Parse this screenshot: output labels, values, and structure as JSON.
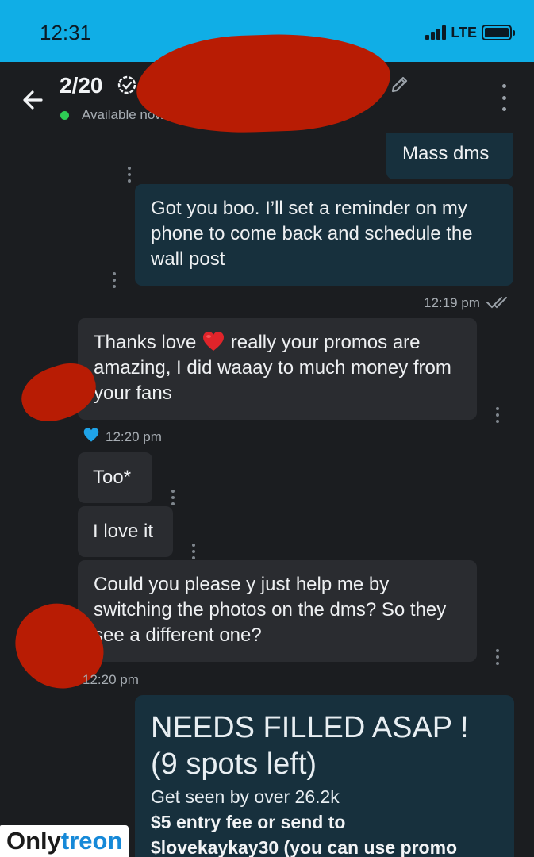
{
  "status_bar": {
    "time": "12:31",
    "network": "LTE"
  },
  "header": {
    "title": "2/20",
    "status": "Available now",
    "icons": [
      "back-arrow-icon",
      "verified-badge-icon",
      "pencil-icon",
      "more-vertical-icon"
    ]
  },
  "messages": [
    {
      "id": "m1",
      "direction": "outgoing",
      "text": "Mass dms"
    },
    {
      "id": "m2",
      "direction": "outgoing",
      "text": "Got you boo. I’ll set a reminder on my phone to come back and schedule the wall post",
      "time": "12:19 pm",
      "read": true
    },
    {
      "id": "m3",
      "direction": "incoming",
      "text_before": "Thanks love",
      "text_after": "really your promos are amazing, I did waaay to much money from your fans",
      "time": "12:20 pm",
      "liked": true
    },
    {
      "id": "m4",
      "direction": "incoming",
      "text": "Too*"
    },
    {
      "id": "m5",
      "direction": "incoming",
      "text": "I love it"
    },
    {
      "id": "m6",
      "direction": "incoming",
      "text": "Could you please y just help me by switching the photos on the dms? So they see a different one?",
      "time": "12:20 pm"
    },
    {
      "id": "m7",
      "direction": "outgoing",
      "headline": "NEEDS FILLED ASAP ! (9 spots left)",
      "line1": "Get seen by over 26.2k",
      "line2": "$5 entry fee or send to",
      "line3": "$lovekaykay30 (you can use promo"
    }
  ],
  "colors": {
    "accent": "#10aee6",
    "outgoing_bubble": "#17303d",
    "incoming_bubble": "#2a2c30",
    "online": "#2ecc54",
    "like": "#1fa3e8"
  },
  "watermark": {
    "part1": "Only",
    "part2": "treon"
  }
}
